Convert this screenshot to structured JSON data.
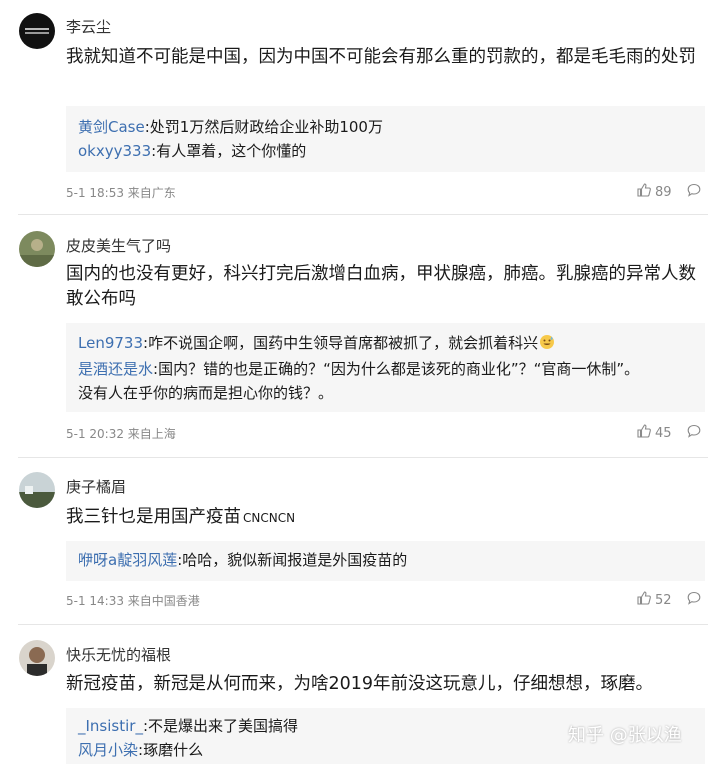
{
  "comments": [
    {
      "username": "李云尘",
      "body": "我就知道不可能是中国，因为中国不可能会有那么重的罚款的，都是毛毛雨的处罚",
      "replies": [
        {
          "name": "黄剑Case",
          "sep": ":",
          "text": "处罚1万然后财政给企业补助100万"
        },
        {
          "name": "okxyy333",
          "sep": ":",
          "text": "有人罩着，这个你懂的"
        }
      ],
      "meta": "5-1 18:53 来自广东",
      "likes": "89"
    },
    {
      "username": "皮皮美生气了吗",
      "body": "国内的也没有更好，科兴打完后激增白血病，甲状腺癌，肺癌。乳腺癌的异常人数敢公布吗",
      "replies": [
        {
          "name": "Len9733",
          "sep": ":",
          "text": "咋不说国企啊，国药中生领导首席都被抓了，就会抓着科兴"
        },
        {
          "name": "是酒还是水",
          "sep": ":",
          "text": "国内？错的也是正确的？“因为什么都是该死的商业化”？“官商一休制”。"
        },
        {
          "name": "",
          "sep": "",
          "text": "没有人在乎你的病而是担心你的钱？。"
        }
      ],
      "meta": "5-1 20:32 来自上海",
      "likes": "45"
    },
    {
      "username": "庚子橘眉",
      "body": "我三针乜是用国产疫苗",
      "body_tag": "CNCNCN",
      "replies": [
        {
          "name": "咿呀a靛羽风莲",
          "sep": ":",
          "text": "哈哈，貌似新闻报道是外国疫苗的"
        }
      ],
      "meta": "5-1 14:33 来自中国香港",
      "likes": "52"
    },
    {
      "username": "快乐无忧的福根",
      "body": "新冠疫苗，新冠是从何而来，为啥2019年前没这玩意儿，仔细想想，琢磨。",
      "replies": [
        {
          "name": "_Insistir_",
          "sep": ":",
          "text": "不是爆出来了美国搞得"
        },
        {
          "name": "风月小染",
          "sep": ":",
          "text": "琢磨什么"
        }
      ]
    }
  ],
  "watermark": "知乎 @张以渔",
  "icons": {
    "like": "thumbs-up-icon",
    "reply": "speech-bubble-icon",
    "emoji": "grinning-sweat-emoji"
  },
  "colors": {
    "reply_name": "#3d6fb0",
    "reply_bg": "#f6f6f6",
    "meta": "#888888"
  }
}
